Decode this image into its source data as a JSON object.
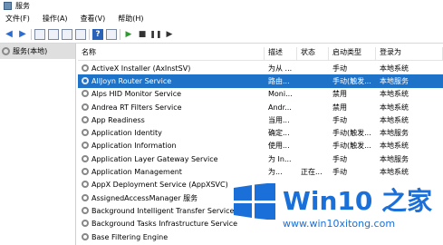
{
  "window": {
    "title": "服务"
  },
  "menu": [
    {
      "label": "文件(F)"
    },
    {
      "label": "操作(A)"
    },
    {
      "label": "查看(V)"
    },
    {
      "label": "帮助(H)"
    }
  ],
  "sidebar": {
    "item": "服务(本地)"
  },
  "columns": {
    "name": "名称",
    "desc": "描述",
    "status": "状态",
    "start": "启动类型",
    "logon": "登录为"
  },
  "services": [
    {
      "name": "ActiveX Installer (AxInstSV)",
      "desc": "为从 ...",
      "status": "",
      "start": "手动",
      "logon": "本地系统"
    },
    {
      "name": "AllJoyn Router Service",
      "desc": "路由...",
      "status": "",
      "start": "手动(触发...",
      "logon": "本地服务",
      "selected": true
    },
    {
      "name": "Alps HID Monitor Service",
      "desc": "Moni...",
      "status": "",
      "start": "禁用",
      "logon": "本地系统"
    },
    {
      "name": "Andrea RT Filters Service",
      "desc": "Andr...",
      "status": "",
      "start": "禁用",
      "logon": "本地系统"
    },
    {
      "name": "App Readiness",
      "desc": "当用...",
      "status": "",
      "start": "手动",
      "logon": "本地系统"
    },
    {
      "name": "Application Identity",
      "desc": "确定...",
      "status": "",
      "start": "手动(触发...",
      "logon": "本地服务"
    },
    {
      "name": "Application Information",
      "desc": "使用...",
      "status": "",
      "start": "手动(触发...",
      "logon": "本地系统"
    },
    {
      "name": "Application Layer Gateway Service",
      "desc": "为 In...",
      "status": "",
      "start": "手动",
      "logon": "本地服务"
    },
    {
      "name": "Application Management",
      "desc": "为...",
      "status": "正在...",
      "start": "手动",
      "logon": "本地系统"
    },
    {
      "name": "AppX Deployment Service (AppXSVC)",
      "desc": "",
      "status": "",
      "start": "",
      "logon": ""
    },
    {
      "name": "AssignedAccessManager 服务",
      "desc": "",
      "status": "",
      "start": "",
      "logon": ""
    },
    {
      "name": "Background Intelligent Transfer Service",
      "desc": "",
      "status": "",
      "start": "",
      "logon": ""
    },
    {
      "name": "Background Tasks Infrastructure Service",
      "desc": "",
      "status": "",
      "start": "",
      "logon": ""
    },
    {
      "name": "Base Filtering Engine",
      "desc": "",
      "status": "",
      "start": "",
      "logon": ""
    }
  ],
  "watermark": {
    "title": "Win10 之家",
    "url": "www.win10xitong.com"
  },
  "colors": {
    "selection": "#1e73c9",
    "watermark": "#1a6fd8"
  }
}
